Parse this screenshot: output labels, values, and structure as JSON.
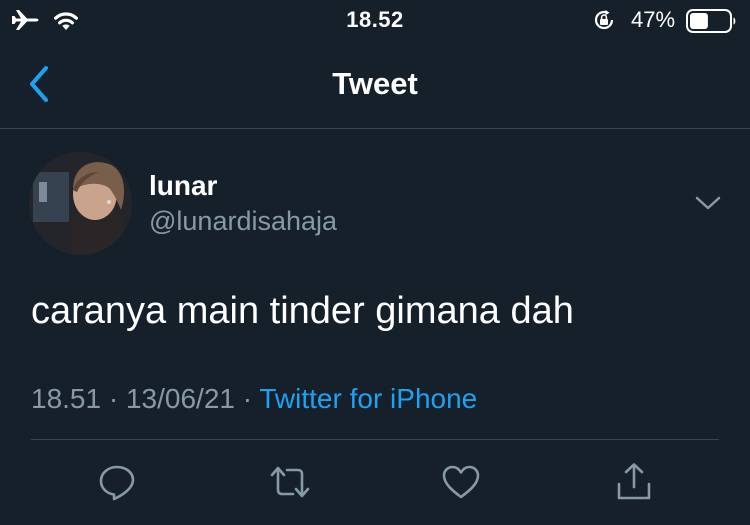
{
  "status_bar": {
    "time": "18.52",
    "battery_percent": "47%",
    "battery_level": 0.47,
    "icons": [
      "airplane-icon",
      "wifi-icon",
      "orientation-lock-icon",
      "battery-icon"
    ]
  },
  "nav": {
    "title": "Tweet",
    "back_icon": "chevron-left-icon"
  },
  "tweet": {
    "author": {
      "display_name": "lunar",
      "handle": "@lunardisahaja"
    },
    "text": "caranya main tinder gimana dah",
    "time": "18.51",
    "separator": "·",
    "date": "13/06/21",
    "source": "Twitter for iPhone"
  },
  "actions": [
    {
      "name": "reply",
      "icon": "reply-icon"
    },
    {
      "name": "retweet",
      "icon": "retweet-icon"
    },
    {
      "name": "like",
      "icon": "heart-icon"
    },
    {
      "name": "share",
      "icon": "share-icon"
    }
  ],
  "colors": {
    "background": "#15202b",
    "text": "#ffffff",
    "secondary_text": "#8899a6",
    "accent": "#1da1f2",
    "divider": "#38444d"
  }
}
